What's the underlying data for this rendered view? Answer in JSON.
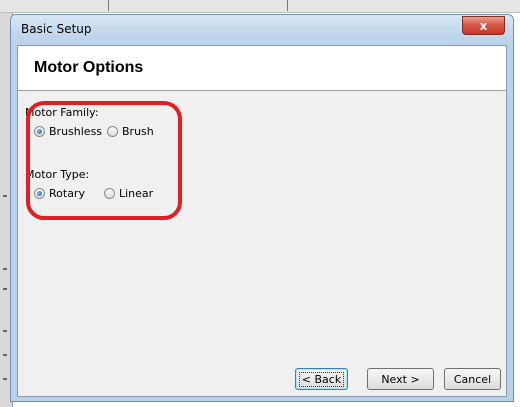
{
  "window": {
    "title": "Basic Setup",
    "close_glyph": "x"
  },
  "page": {
    "title": "Motor Options"
  },
  "motor_family": {
    "label": "Motor Family:",
    "options": [
      {
        "label": "Brushless",
        "selected": true
      },
      {
        "label": "Brush",
        "selected": false
      }
    ]
  },
  "motor_type": {
    "label": "Motor Type:",
    "options": [
      {
        "label": "Rotary",
        "selected": true
      },
      {
        "label": "Linear",
        "selected": false
      }
    ]
  },
  "buttons": {
    "back": "< Back",
    "next": "Next >",
    "cancel": "Cancel"
  },
  "colors": {
    "highlight": "#e31e24",
    "close": "#c2382b",
    "frame": "#b9d1ea"
  }
}
